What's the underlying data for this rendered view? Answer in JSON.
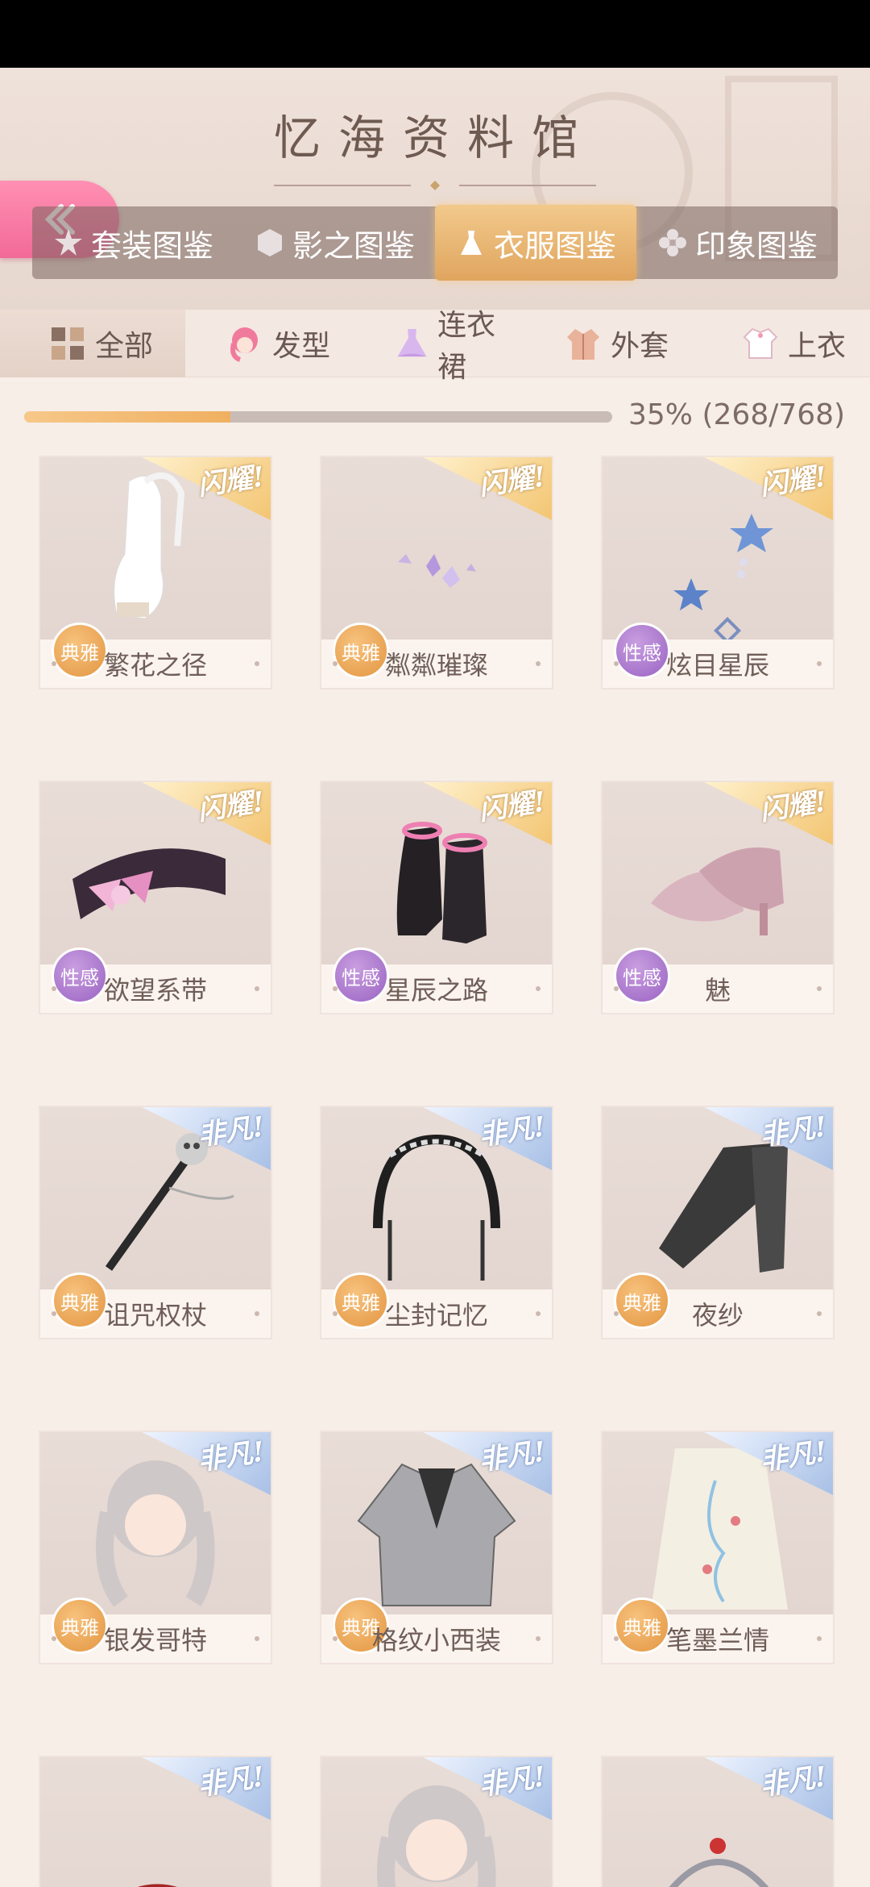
{
  "header": {
    "title": "忆海资料馆",
    "back_icon": "double-chevron-left-icon",
    "main_tabs": [
      {
        "label": "套装图鉴",
        "icon": "star-icon",
        "active": false
      },
      {
        "label": "影之图鉴",
        "icon": "hexagon-icon",
        "active": false
      },
      {
        "label": "衣服图鉴",
        "icon": "dress-icon",
        "active": true
      },
      {
        "label": "印象图鉴",
        "icon": "flower-icon",
        "active": false
      }
    ]
  },
  "sub_tabs": [
    {
      "label": "全部",
      "icon": "grid-icon",
      "active": true
    },
    {
      "label": "发型",
      "icon": "hair-icon",
      "active": false
    },
    {
      "label": "连衣裙",
      "icon": "dress-icon",
      "active": false
    },
    {
      "label": "外套",
      "icon": "coat-icon",
      "active": false
    },
    {
      "label": "上衣",
      "icon": "shirt-icon",
      "active": false
    }
  ],
  "progress": {
    "fraction": 0.35,
    "text": "35% (268/768)"
  },
  "items": [
    {
      "name": "繁花之径",
      "rarity": "闪耀!",
      "tier": "gold",
      "tag": "典雅",
      "tag_type": "elegant",
      "icon": "shoes-icon"
    },
    {
      "name": "粼粼璀璨",
      "rarity": "闪耀!",
      "tier": "gold",
      "tag": "典雅",
      "tag_type": "elegant",
      "icon": "gems-icon"
    },
    {
      "name": "炫目星辰",
      "rarity": "闪耀!",
      "tier": "gold",
      "tag": "性感",
      "tag_type": "sexy",
      "icon": "star-earring-icon"
    },
    {
      "name": "欲望系带",
      "rarity": "闪耀!",
      "tier": "gold",
      "tag": "性感",
      "tag_type": "sexy",
      "icon": "choker-icon"
    },
    {
      "name": "星辰之路",
      "rarity": "闪耀!",
      "tier": "gold",
      "tag": "性感",
      "tag_type": "sexy",
      "icon": "boots-icon"
    },
    {
      "name": "魅",
      "rarity": "闪耀!",
      "tier": "gold",
      "tag": "性感",
      "tag_type": "sexy",
      "icon": "heels-icon"
    },
    {
      "name": "诅咒权杖",
      "rarity": "非凡!",
      "tier": "blue",
      "tag": "典雅",
      "tag_type": "elegant",
      "icon": "staff-icon"
    },
    {
      "name": "尘封记忆",
      "rarity": "非凡!",
      "tier": "blue",
      "tag": "典雅",
      "tag_type": "elegant",
      "icon": "headband-icon"
    },
    {
      "name": "夜纱",
      "rarity": "非凡!",
      "tier": "blue",
      "tag": "典雅",
      "tag_type": "elegant",
      "icon": "stockings-icon"
    },
    {
      "name": "银发哥特",
      "rarity": "非凡!",
      "tier": "blue",
      "tag": "典雅",
      "tag_type": "elegant",
      "icon": "hairstyle-icon"
    },
    {
      "name": "格纹小西装",
      "rarity": "非凡!",
      "tier": "blue",
      "tag": "典雅",
      "tag_type": "elegant",
      "icon": "blazer-icon"
    },
    {
      "name": "笔墨兰情",
      "rarity": "非凡!",
      "tier": "blue",
      "tag": "典雅",
      "tag_type": "elegant",
      "icon": "skirt-icon"
    },
    {
      "name": "",
      "rarity": "非凡!",
      "tier": "blue",
      "tag": "",
      "tag_type": "",
      "icon": "hat-icon"
    },
    {
      "name": "",
      "rarity": "非凡!",
      "tier": "blue",
      "tag": "",
      "tag_type": "",
      "icon": "hairstyle-icon"
    },
    {
      "name": "",
      "rarity": "非凡!",
      "tier": "blue",
      "tag": "",
      "tag_type": "",
      "icon": "hairpin-icon"
    }
  ]
}
